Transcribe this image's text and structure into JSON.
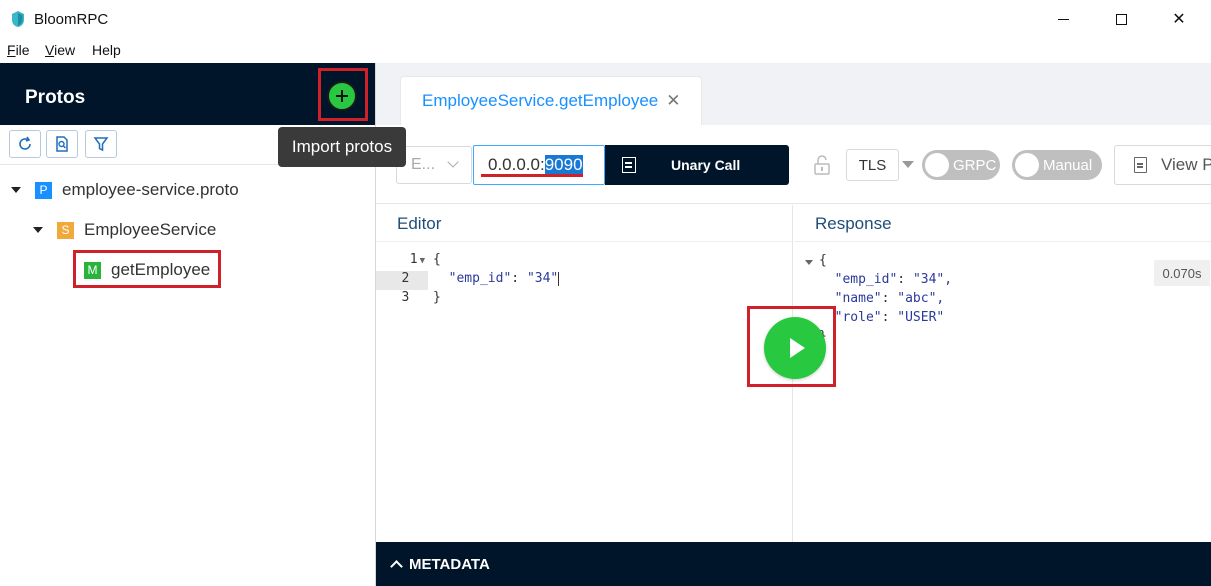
{
  "window": {
    "title": "BloomRPC",
    "minimize_label": "",
    "maximize_label": "",
    "close_label": "✕"
  },
  "menu": {
    "items": [
      {
        "label": "File",
        "mnemonic": "F",
        "rest": "ile"
      },
      {
        "label": "View",
        "mnemonic": "V",
        "rest": "iew"
      },
      {
        "label": "Help",
        "mnemonic": "",
        "rest": "Help"
      }
    ]
  },
  "sidebar": {
    "title": "Protos",
    "import_button_icon": "plus-icon",
    "tooltip": "Import protos",
    "tools": [
      "reload-icon",
      "file-search-icon",
      "filter-icon"
    ],
    "tree": {
      "proto": {
        "badge": "P",
        "label": "employee-service.proto"
      },
      "service": {
        "badge": "S",
        "label": "EmployeeService"
      },
      "method": {
        "badge": "M",
        "label": "getEmployee"
      }
    }
  },
  "tabs": [
    {
      "label": "EmployeeService.getEmployee",
      "close": "✕"
    }
  ],
  "controls": {
    "env_select": "E...",
    "address_prefix": "0.0.0.0:",
    "address_selected": "9090",
    "call_type": "Unary Call",
    "tls_label": "TLS",
    "grpc_label": "GRPC",
    "manual_label": "Manual",
    "view_label": "View P"
  },
  "editor": {
    "title": "Editor",
    "lines": [
      {
        "num": "1",
        "text": "{"
      },
      {
        "num": "2",
        "key": "\"emp_id\"",
        "value": "\"34\""
      },
      {
        "num": "3",
        "text": "}"
      }
    ]
  },
  "response": {
    "title": "Response",
    "time": "0.070s",
    "lines": [
      {
        "text": "{"
      },
      {
        "key": "\"emp_id\"",
        "value": "\"34\","
      },
      {
        "key": "\"name\"",
        "value": "\"abc\","
      },
      {
        "key": "\"role\"",
        "value": "\"USER\""
      },
      {
        "text": "}"
      }
    ]
  },
  "metadata": {
    "label": "METADATA"
  },
  "colors": {
    "navy": "#001529",
    "green": "#28c840",
    "accent_blue": "#1890ff",
    "highlight_red": "#d0202a"
  }
}
